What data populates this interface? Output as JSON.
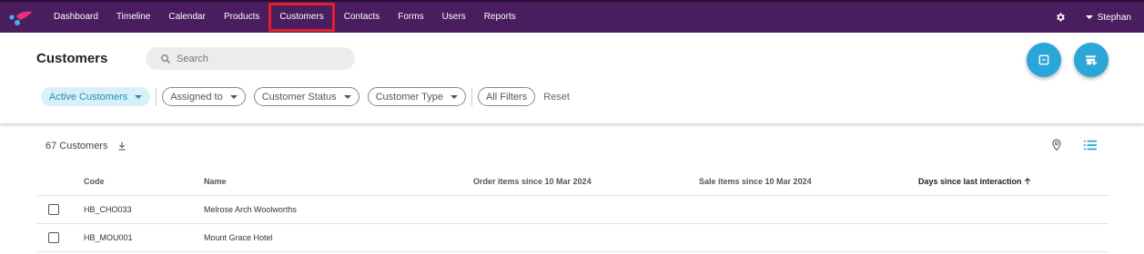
{
  "nav": {
    "items": [
      "Dashboard",
      "Timeline",
      "Calendar",
      "Products",
      "Customers",
      "Contacts",
      "Forms",
      "Users",
      "Reports"
    ],
    "active": "Customers",
    "user": "Stephan",
    "colors": {
      "bar": "#4a1d5e",
      "highlight": "#e0202a"
    }
  },
  "header": {
    "title": "Customers",
    "search_placeholder": "Search",
    "filters": {
      "active_customers": "Active Customers",
      "assigned_to": "Assigned to",
      "customer_status": "Customer Status",
      "customer_type": "Customer Type",
      "all_filters": "All Filters",
      "reset": "Reset"
    },
    "accent": "#2aa7d8"
  },
  "list": {
    "count": "67 Customers",
    "columns": {
      "code": "Code",
      "name": "Name",
      "order_items": "Order items since 10 Mar 2024",
      "sale_items": "Sale items since 10 Mar 2024",
      "days": "Days since last interaction"
    },
    "rows": [
      {
        "code": "HB_CHO033",
        "name": "Melrose Arch Woolworths"
      },
      {
        "code": "HB_MOU001",
        "name": "Mount Grace Hotel"
      }
    ]
  }
}
